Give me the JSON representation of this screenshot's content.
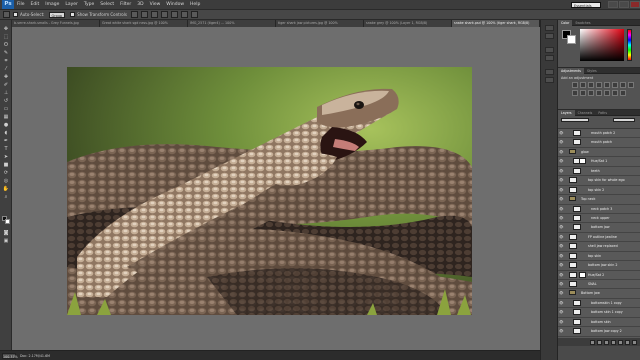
{
  "app": {
    "logo": "Ps"
  },
  "menu": [
    "File",
    "Edit",
    "Image",
    "Layer",
    "Type",
    "Select",
    "Filter",
    "3D",
    "View",
    "Window",
    "Help"
  ],
  "workspace": "Essentials",
  "options_bar": {
    "auto_select_label": "Auto-Select:",
    "auto_select_value": "Group",
    "show_transform_label": "Show Transform Controls"
  },
  "tabs": [
    {
      "label": "b-verre-shark-smalls - Grey Funnels.jpg",
      "active": false
    },
    {
      "label": "Great white shark sgd ness.jpg @ 100%",
      "active": false
    },
    {
      "label": "IMG_2571 (tiger4) ... 100%",
      "active": false
    },
    {
      "label": "tiger shark jaw pictures.jpg @ 100%",
      "active": false
    },
    {
      "label": "snake grey @ 100% (Layer 1, RGB/8)",
      "active": false
    },
    {
      "label": "snake shark.psd @ 100% (tiger shark, RGB/8)",
      "active": true
    }
  ],
  "status": {
    "zoom": "100.37%",
    "doc": "Doc: 2.17M/41.6M"
  },
  "panels": {
    "color_tabs": [
      "Color",
      "Swatches"
    ],
    "adjust_tabs": [
      "Adjustments",
      "Styles"
    ],
    "adjust_title": "Add an adjustment",
    "layers_tabs": [
      "Layers",
      "Channels",
      "Paths"
    ]
  },
  "layers": [
    {
      "name": "mouth patch 2",
      "indent": 1,
      "folder": false,
      "mask": false
    },
    {
      "name": "mouth patch",
      "indent": 1,
      "folder": false,
      "mask": false
    },
    {
      "name": "glow",
      "indent": 0,
      "folder": true,
      "mask": false
    },
    {
      "name": "Hue/Sat 1",
      "indent": 1,
      "folder": false,
      "mask": true
    },
    {
      "name": "teeth",
      "indent": 1,
      "folder": false,
      "mask": false
    },
    {
      "name": "top skin for whole ego",
      "indent": 0,
      "folder": false,
      "mask": false
    },
    {
      "name": "top skin 2",
      "indent": 0,
      "folder": false,
      "mask": false
    },
    {
      "name": "Top neck",
      "indent": 0,
      "folder": true,
      "mask": false
    },
    {
      "name": "neck patch 3",
      "indent": 1,
      "folder": false,
      "mask": false
    },
    {
      "name": "neck upper",
      "indent": 1,
      "folder": false,
      "mask": false
    },
    {
      "name": "bottom jaw",
      "indent": 1,
      "folder": false,
      "mask": false
    },
    {
      "name": "FP outline jawline",
      "indent": 0,
      "folder": false,
      "mask": false
    },
    {
      "name": "shell jaw replaced",
      "indent": 0,
      "folder": false,
      "mask": false
    },
    {
      "name": "top skin",
      "indent": 0,
      "folder": false,
      "mask": false
    },
    {
      "name": "bottom jaw skin 2",
      "indent": 0,
      "folder": false,
      "mask": false
    },
    {
      "name": "Hue/Sat 2",
      "indent": 0,
      "folder": false,
      "mask": true
    },
    {
      "name": "SNAL",
      "indent": 0,
      "folder": false,
      "mask": false
    },
    {
      "name": "Bottom jaw",
      "indent": 0,
      "folder": true,
      "mask": false
    },
    {
      "name": "bottomskin 1 copy",
      "indent": 1,
      "folder": false,
      "mask": false
    },
    {
      "name": "bottom skin 1 copy",
      "indent": 1,
      "folder": false,
      "mask": false
    },
    {
      "name": "bottom skin",
      "indent": 1,
      "folder": false,
      "mask": false
    },
    {
      "name": "bottom jaw copy 2",
      "indent": 1,
      "folder": false,
      "mask": false
    },
    {
      "name": "bottom jaw copy",
      "indent": 1,
      "folder": false,
      "mask": false
    }
  ],
  "colors": {
    "accent": "#6f8fc2",
    "canvas_bg": "#6e6e6e",
    "chrome": "#404040"
  }
}
